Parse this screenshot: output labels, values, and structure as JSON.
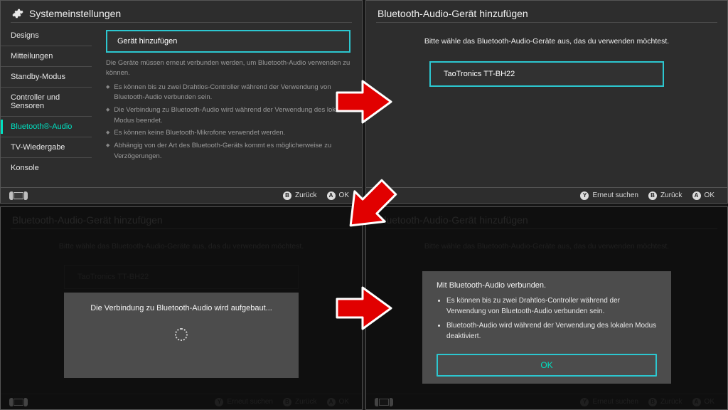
{
  "pane1": {
    "title": "Systemeinstellungen",
    "sidebar": {
      "items": [
        "Designs",
        "Mitteilungen",
        "Standby-Modus",
        "Controller und Sensoren",
        "Bluetooth®-Audio",
        "TV-Wiedergabe",
        "Konsole"
      ],
      "active_index": 4
    },
    "main": {
      "add_label": "Gerät hinzufügen",
      "note": "Die Geräte müssen erneut verbunden werden, um Bluetooth-Audio verwenden zu können.",
      "bullets": [
        "Es können bis zu zwei Drahtlos-Controller während der Verwendung von Bluetooth-Audio verbunden sein.",
        "Die Verbindung zu Bluetooth-Audio wird während der Verwendung des lokalen Modus beendet.",
        "Es können keine Bluetooth-Mikrofone verwendet werden.",
        "Abhängig von der Art des Bluetooth-Geräts kommt es möglicherweise zu Verzögerungen."
      ]
    },
    "footer": {
      "back": "Zurück",
      "ok": "OK",
      "b": "B",
      "a": "A"
    }
  },
  "pane2": {
    "title": "Bluetooth-Audio-Gerät hinzufügen",
    "prompt": "Bitte wähle das Bluetooth-Audio-Geräte aus, das du verwenden möchtest.",
    "device": "TaoTronics TT-BH22",
    "footer": {
      "rescan": "Erneut suchen",
      "back": "Zurück",
      "ok": "OK",
      "y": "Y",
      "b": "B",
      "a": "A"
    }
  },
  "pane3": {
    "title": "Bluetooth-Audio-Gerät hinzufügen",
    "prompt": "Bitte wähle das Bluetooth-Audio-Geräte aus, das du verwenden möchtest.",
    "device": "TaoTronics TT-BH22",
    "modal_text": "Die Verbindung zu Bluetooth-Audio wird aufgebaut...",
    "footer": {
      "rescan": "Erneut suchen",
      "back": "Zurück",
      "ok": "OK",
      "y": "Y",
      "b": "B",
      "a": "A"
    }
  },
  "pane4": {
    "title": "Bluetooth-Audio-Gerät hinzufügen",
    "modal_head": "Mit Bluetooth-Audio verbunden.",
    "modal_bullets": [
      "Es können bis zu zwei Drahtlos-Controller während der Verwendung von Bluetooth-Audio verbunden sein.",
      "Bluetooth-Audio wird während der Verwendung des lokalen Modus deaktiviert."
    ],
    "ok": "OK",
    "footer": {
      "rescan": "Erneut suchen",
      "back": "Zurück",
      "ok": "OK",
      "y": "Y",
      "b": "B",
      "a": "A"
    }
  }
}
